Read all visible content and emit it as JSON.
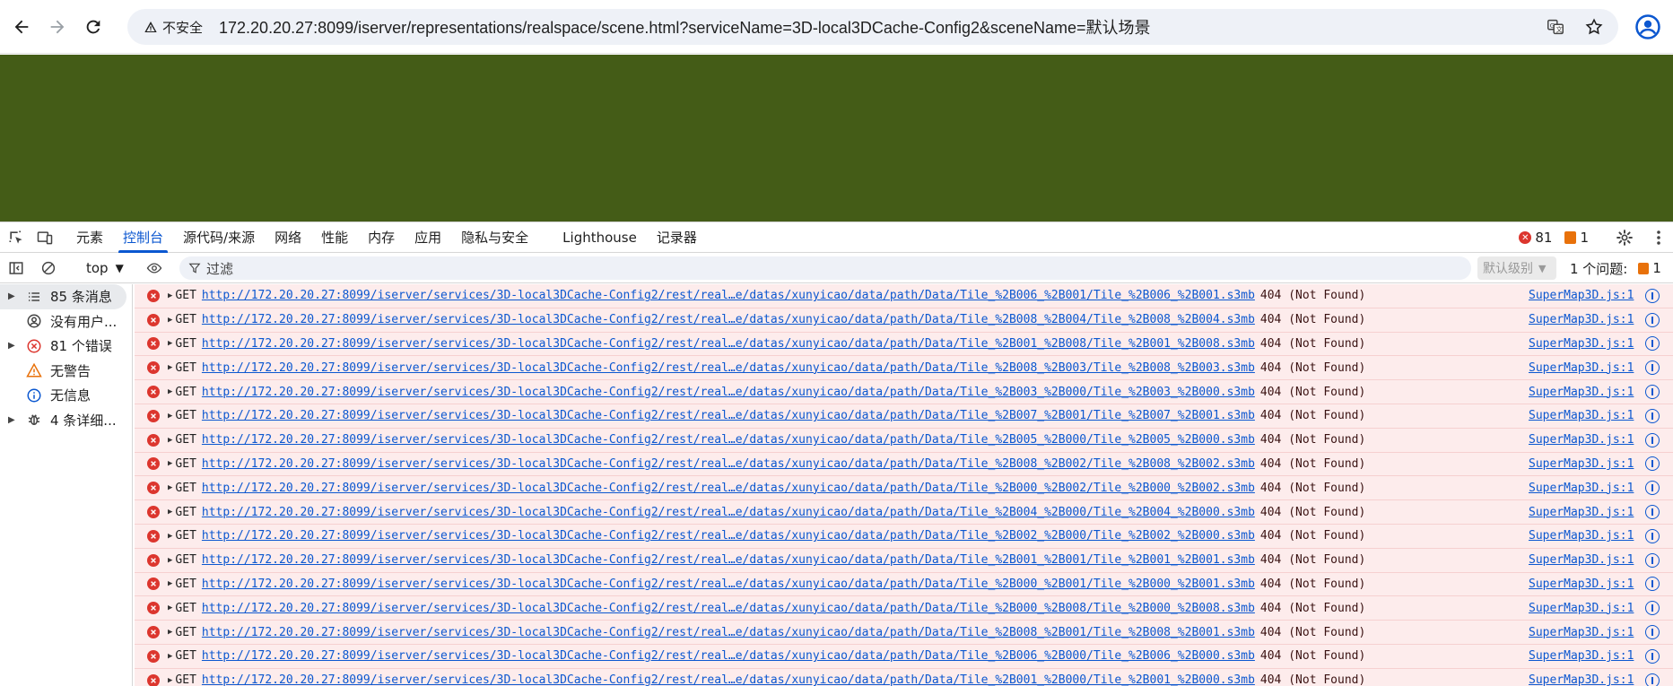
{
  "browser": {
    "security_label": "不安全",
    "url": "172.20.20.27:8099/iserver/representations/realspace/scene.html?serviceName=3D-local3DCache-Config2&sceneName=默认场景"
  },
  "page": {
    "background_color": "#445c17"
  },
  "devtools": {
    "tabs": [
      {
        "label": "元素"
      },
      {
        "label": "控制台"
      },
      {
        "label": "源代码/来源"
      },
      {
        "label": "网络"
      },
      {
        "label": "性能"
      },
      {
        "label": "内存"
      },
      {
        "label": "应用"
      },
      {
        "label": "隐私与安全"
      },
      {
        "label": "Lighthouse"
      },
      {
        "label": "记录器"
      }
    ],
    "active_tab": "控制台",
    "error_count": "81",
    "warning_count": "1",
    "console": {
      "context": "top",
      "filter_placeholder": "过滤",
      "level": "默认级别",
      "issues_label": "1 个问题:",
      "issues_count": "1"
    },
    "sidebar": [
      {
        "label": "85 条消息",
        "icon": "list-icon"
      },
      {
        "label": "没有用户...",
        "icon": "user-icon"
      },
      {
        "label": "81 个错误",
        "icon": "error-icon"
      },
      {
        "label": "无警告",
        "icon": "warning-icon"
      },
      {
        "label": "无信息",
        "icon": "info-icon"
      },
      {
        "label": "4 条详细...",
        "icon": "bug-icon"
      }
    ],
    "messages": [
      {
        "method": "GET",
        "url": "http://172.20.20.27:8099/iserver/services/3D-local3DCache-Config2/rest/real…e/datas/xunyicao/data/path/Data/Tile_%2B006_%2B001/Tile_%2B006_%2B001.s3mb",
        "status": "404 (Not Found)",
        "source": "SuperMap3D.js:1"
      },
      {
        "method": "GET",
        "url": "http://172.20.20.27:8099/iserver/services/3D-local3DCache-Config2/rest/real…e/datas/xunyicao/data/path/Data/Tile_%2B008_%2B004/Tile_%2B008_%2B004.s3mb",
        "status": "404 (Not Found)",
        "source": "SuperMap3D.js:1"
      },
      {
        "method": "GET",
        "url": "http://172.20.20.27:8099/iserver/services/3D-local3DCache-Config2/rest/real…e/datas/xunyicao/data/path/Data/Tile_%2B001_%2B008/Tile_%2B001_%2B008.s3mb",
        "status": "404 (Not Found)",
        "source": "SuperMap3D.js:1"
      },
      {
        "method": "GET",
        "url": "http://172.20.20.27:8099/iserver/services/3D-local3DCache-Config2/rest/real…e/datas/xunyicao/data/path/Data/Tile_%2B008_%2B003/Tile_%2B008_%2B003.s3mb",
        "status": "404 (Not Found)",
        "source": "SuperMap3D.js:1"
      },
      {
        "method": "GET",
        "url": "http://172.20.20.27:8099/iserver/services/3D-local3DCache-Config2/rest/real…e/datas/xunyicao/data/path/Data/Tile_%2B003_%2B000/Tile_%2B003_%2B000.s3mb",
        "status": "404 (Not Found)",
        "source": "SuperMap3D.js:1"
      },
      {
        "method": "GET",
        "url": "http://172.20.20.27:8099/iserver/services/3D-local3DCache-Config2/rest/real…e/datas/xunyicao/data/path/Data/Tile_%2B007_%2B001/Tile_%2B007_%2B001.s3mb",
        "status": "404 (Not Found)",
        "source": "SuperMap3D.js:1"
      },
      {
        "method": "GET",
        "url": "http://172.20.20.27:8099/iserver/services/3D-local3DCache-Config2/rest/real…e/datas/xunyicao/data/path/Data/Tile_%2B005_%2B000/Tile_%2B005_%2B000.s3mb",
        "status": "404 (Not Found)",
        "source": "SuperMap3D.js:1"
      },
      {
        "method": "GET",
        "url": "http://172.20.20.27:8099/iserver/services/3D-local3DCache-Config2/rest/real…e/datas/xunyicao/data/path/Data/Tile_%2B008_%2B002/Tile_%2B008_%2B002.s3mb",
        "status": "404 (Not Found)",
        "source": "SuperMap3D.js:1"
      },
      {
        "method": "GET",
        "url": "http://172.20.20.27:8099/iserver/services/3D-local3DCache-Config2/rest/real…e/datas/xunyicao/data/path/Data/Tile_%2B000_%2B002/Tile_%2B000_%2B002.s3mb",
        "status": "404 (Not Found)",
        "source": "SuperMap3D.js:1"
      },
      {
        "method": "GET",
        "url": "http://172.20.20.27:8099/iserver/services/3D-local3DCache-Config2/rest/real…e/datas/xunyicao/data/path/Data/Tile_%2B004_%2B000/Tile_%2B004_%2B000.s3mb",
        "status": "404 (Not Found)",
        "source": "SuperMap3D.js:1"
      },
      {
        "method": "GET",
        "url": "http://172.20.20.27:8099/iserver/services/3D-local3DCache-Config2/rest/real…e/datas/xunyicao/data/path/Data/Tile_%2B002_%2B000/Tile_%2B002_%2B000.s3mb",
        "status": "404 (Not Found)",
        "source": "SuperMap3D.js:1"
      },
      {
        "method": "GET",
        "url": "http://172.20.20.27:8099/iserver/services/3D-local3DCache-Config2/rest/real…e/datas/xunyicao/data/path/Data/Tile_%2B001_%2B001/Tile_%2B001_%2B001.s3mb",
        "status": "404 (Not Found)",
        "source": "SuperMap3D.js:1"
      },
      {
        "method": "GET",
        "url": "http://172.20.20.27:8099/iserver/services/3D-local3DCache-Config2/rest/real…e/datas/xunyicao/data/path/Data/Tile_%2B000_%2B001/Tile_%2B000_%2B001.s3mb",
        "status": "404 (Not Found)",
        "source": "SuperMap3D.js:1"
      },
      {
        "method": "GET",
        "url": "http://172.20.20.27:8099/iserver/services/3D-local3DCache-Config2/rest/real…e/datas/xunyicao/data/path/Data/Tile_%2B000_%2B008/Tile_%2B000_%2B008.s3mb",
        "status": "404 (Not Found)",
        "source": "SuperMap3D.js:1"
      },
      {
        "method": "GET",
        "url": "http://172.20.20.27:8099/iserver/services/3D-local3DCache-Config2/rest/real…e/datas/xunyicao/data/path/Data/Tile_%2B008_%2B001/Tile_%2B008_%2B001.s3mb",
        "status": "404 (Not Found)",
        "source": "SuperMap3D.js:1"
      },
      {
        "method": "GET",
        "url": "http://172.20.20.27:8099/iserver/services/3D-local3DCache-Config2/rest/real…e/datas/xunyicao/data/path/Data/Tile_%2B006_%2B000/Tile_%2B006_%2B000.s3mb",
        "status": "404 (Not Found)",
        "source": "SuperMap3D.js:1"
      },
      {
        "method": "GET",
        "url": "http://172.20.20.27:8099/iserver/services/3D-local3DCache-Config2/rest/real…e/datas/xunyicao/data/path/Data/Tile_%2B001_%2B000/Tile_%2B001_%2B000.s3mb",
        "status": "404 (Not Found)",
        "source": "SuperMap3D.js:1"
      }
    ]
  }
}
